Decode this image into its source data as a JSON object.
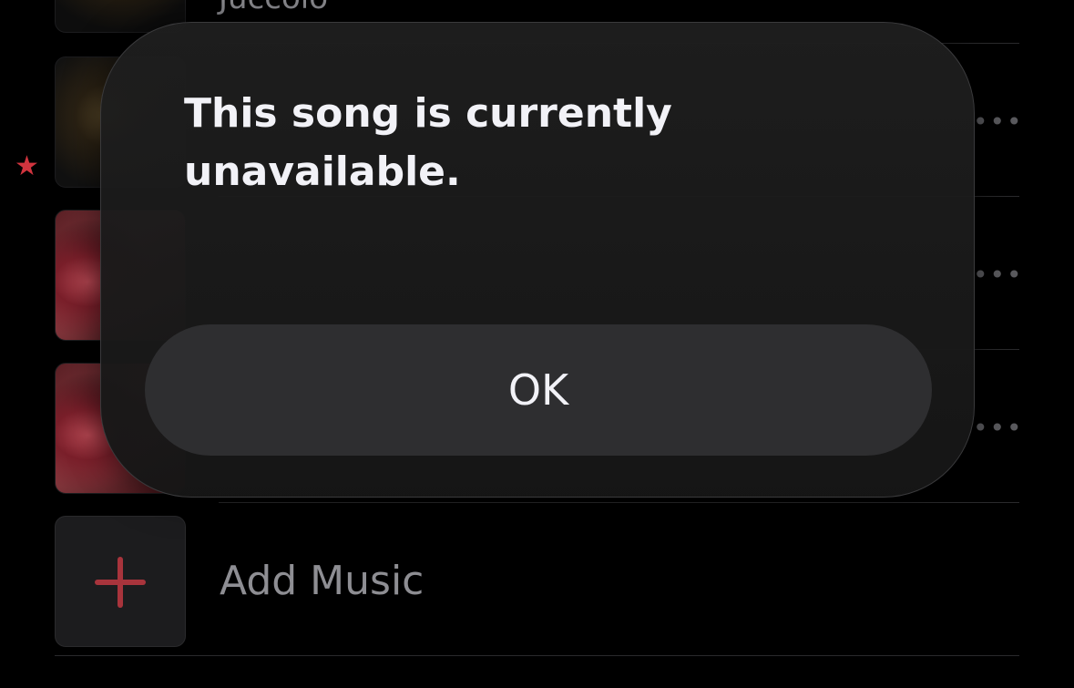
{
  "list": {
    "previous_item_subtitle": "Juccolo",
    "add_music_label": "Add Music"
  },
  "alert": {
    "title": "This song is currently unavailable.",
    "ok_label": "OK"
  },
  "colors": {
    "accent": "#d1343e",
    "background": "#000000",
    "alert_background": "#1e1e1e",
    "button_background": "#2e2e30",
    "secondary_text": "#8e8e93"
  }
}
